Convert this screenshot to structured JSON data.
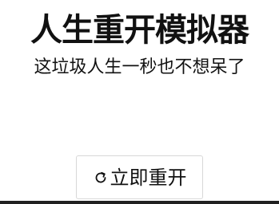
{
  "header": {
    "title": "人生重开模拟器",
    "subtitle": "这垃圾人生一秒也不想呆了"
  },
  "actions": {
    "restart_label": "立即重开",
    "restart_icon": "restart-icon"
  }
}
